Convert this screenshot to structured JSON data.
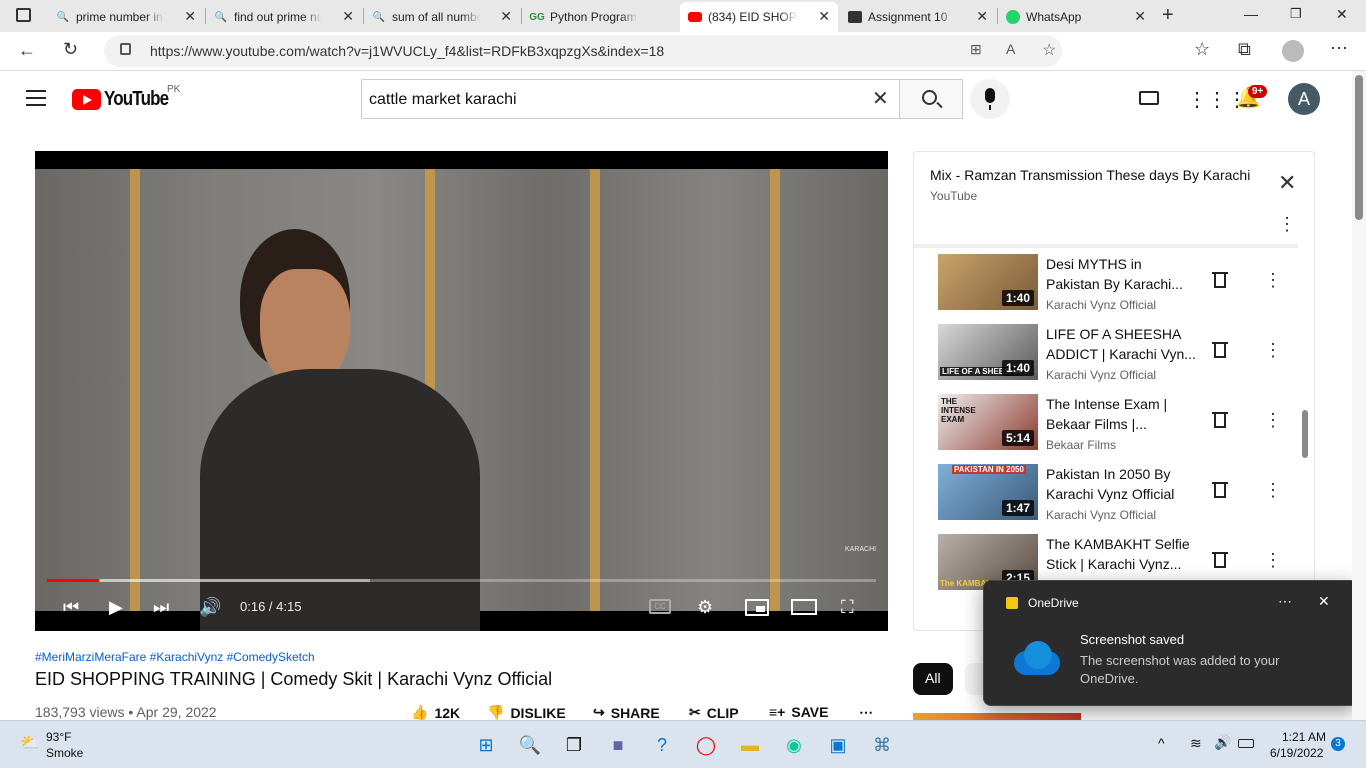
{
  "browser": {
    "tabs": [
      {
        "title": "prime number in"
      },
      {
        "title": "find out prime nu"
      },
      {
        "title": "sum of all numbe"
      },
      {
        "title": "Python Program f"
      },
      {
        "title": "(834) EID SHOPPI"
      },
      {
        "title": "Assignment 10"
      },
      {
        "title": "WhatsApp"
      }
    ],
    "url": "https://www.youtube.com/watch?v=j1WVUCLy_f4&list=RDFkB3xqpzgXs&index=18"
  },
  "header": {
    "logo_text": "YouTube",
    "country": "PK",
    "search_value": "cattle market karachi",
    "notification_count": "9+",
    "avatar_letter": "A"
  },
  "player": {
    "time": "0:16 / 4:15",
    "progress_fraction": 0.063,
    "buffered_fraction": 0.39,
    "watermark": "KARACHI"
  },
  "video": {
    "hashtags": "#MeriMarziMeraFare #KarachiVynz #ComedySketch",
    "title": "EID SHOPPING TRAINING | Comedy Skit | Karachi Vynz Official",
    "meta": "183,793 views • Apr 29, 2022",
    "likes": "12K",
    "dislike": "DISLIKE",
    "share": "SHARE",
    "clip": "CLIP",
    "save": "SAVE"
  },
  "playlist": {
    "title": "Mix - Ramzan Transmission These days By Karachi",
    "owner": "YouTube",
    "items": [
      {
        "title": "Desi MYTHS in Pakistan By Karachi...",
        "channel": "Karachi Vynz Official",
        "duration": "1:40"
      },
      {
        "title": "LIFE OF A SHEESHA ADDICT | Karachi Vyn...",
        "channel": "Karachi Vynz Official",
        "duration": "1:40",
        "thumb_text": "LIFE OF A SHEESHA"
      },
      {
        "title": "The Intense Exam | Bekaar Films |...",
        "channel": "Bekaar Films",
        "duration": "5:14",
        "thumb_text": "THE INTENSE EXAM"
      },
      {
        "title": "Pakistan In 2050 By Karachi Vynz Official",
        "channel": "Karachi Vynz Official",
        "duration": "1:47",
        "thumb_text": "PAKISTAN IN 2050"
      },
      {
        "title": "The KAMBAKHT Selfie Stick | Karachi Vynz...",
        "channel": "",
        "duration": "2:15",
        "thumb_text": "The KAMBAKH"
      }
    ]
  },
  "chips": {
    "all": "All"
  },
  "toast": {
    "app": "OneDrive",
    "title": "Screenshot saved",
    "body": "The screenshot was added to your OneDrive."
  },
  "taskbar": {
    "temp": "93°F",
    "weather": "Smoke",
    "time": "1:21 AM",
    "date": "6/19/2022",
    "notif": "3"
  }
}
